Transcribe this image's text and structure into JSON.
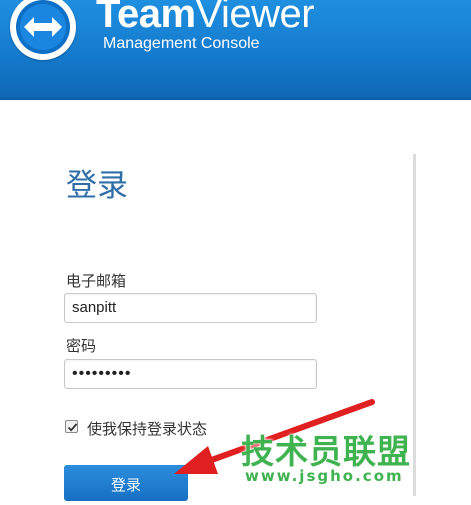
{
  "header": {
    "brand_bold": "Team",
    "brand_light": "Viewer",
    "subtitle": "Management Console",
    "logo_icon": "teamviewer-logo-icon"
  },
  "login": {
    "title": "登录",
    "email_label": "电子邮箱",
    "email_value": "sanpitt",
    "password_label": "密码",
    "password_value": "•••••••••",
    "remember_label": "使我保持登录状态",
    "remember_checked": true,
    "submit_label": "登录"
  },
  "watermark": {
    "text": "技术员联盟",
    "url": "www.jsgho.com"
  },
  "colors": {
    "header_blue": "#1479cc",
    "title_blue": "#2f6fa8",
    "button_blue": "#1670c4",
    "arrow_red": "#e02020",
    "watermark_green": "#3fb34f"
  }
}
